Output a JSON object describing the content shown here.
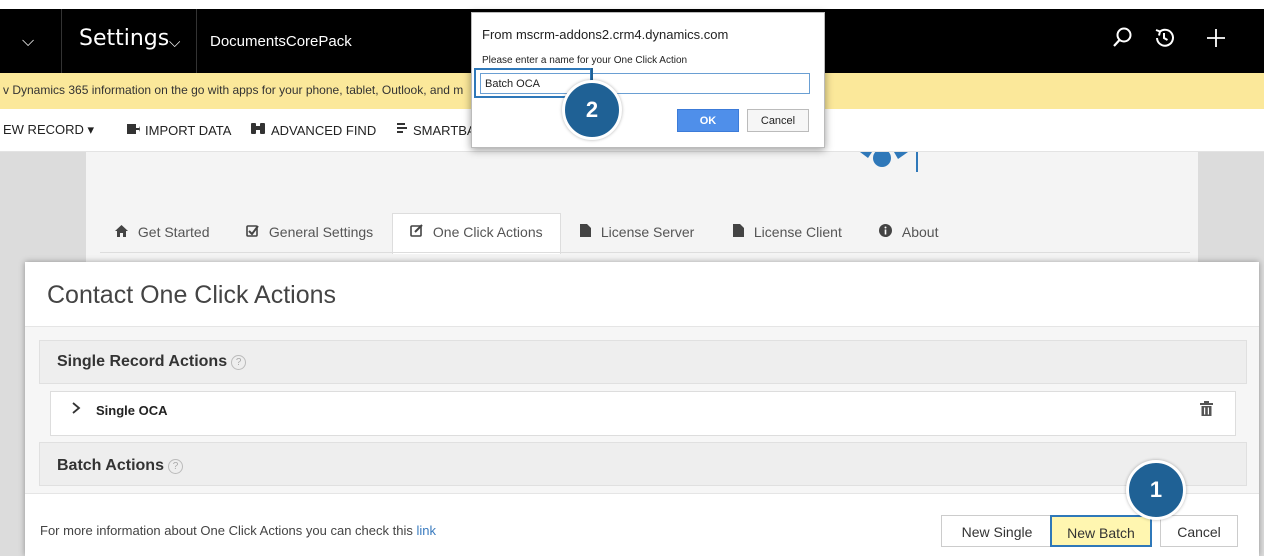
{
  "topbar": {
    "menu_chevron": "⌵",
    "area_label": "Settings",
    "area_chevron": "⌵",
    "entity_label": "DocumentsCorePack",
    "icons": [
      "search-icon",
      "history-icon",
      "plus-icon"
    ]
  },
  "notification": {
    "text": "v Dynamics 365 information on the go with apps for your phone, tablet, Outlook, and m"
  },
  "commandbar": {
    "new_record": "EW RECORD ▾",
    "import_data": "IMPORT DATA",
    "advanced_find": "ADVANCED FIND",
    "smartbar": "SMARTBA"
  },
  "tabs": [
    {
      "icon": "home-icon",
      "label": "Get Started"
    },
    {
      "icon": "checkbox-icon",
      "label": "General Settings"
    },
    {
      "icon": "edit-icon",
      "label": "One Click Actions"
    },
    {
      "icon": "file-icon",
      "label": "License Server"
    },
    {
      "icon": "file-icon",
      "label": "License Client"
    },
    {
      "icon": "info-icon",
      "label": "About"
    }
  ],
  "modal": {
    "title": "Contact One Click Actions",
    "single_section": "Single Record Actions",
    "single_item": "Single OCA",
    "batch_section": "Batch Actions",
    "footer_text": "For more information about One Click Actions you can check this ",
    "footer_link": "link",
    "buttons": {
      "new_single": "New Single",
      "new_batch": "New Batch",
      "cancel": "Cancel"
    }
  },
  "prompt": {
    "from": "From mscrm-addons2.crm4.dynamics.com",
    "message": "Please enter a name for your One Click Action",
    "input_value": "Batch OCA",
    "ok": "OK",
    "cancel": "Cancel"
  },
  "badges": [
    "1",
    "2"
  ],
  "colors": {
    "accent": "#1f6195",
    "notification_bg": "#fbe89a",
    "highlight_button": "#fff6b0",
    "ok_button": "#4f8fea"
  }
}
